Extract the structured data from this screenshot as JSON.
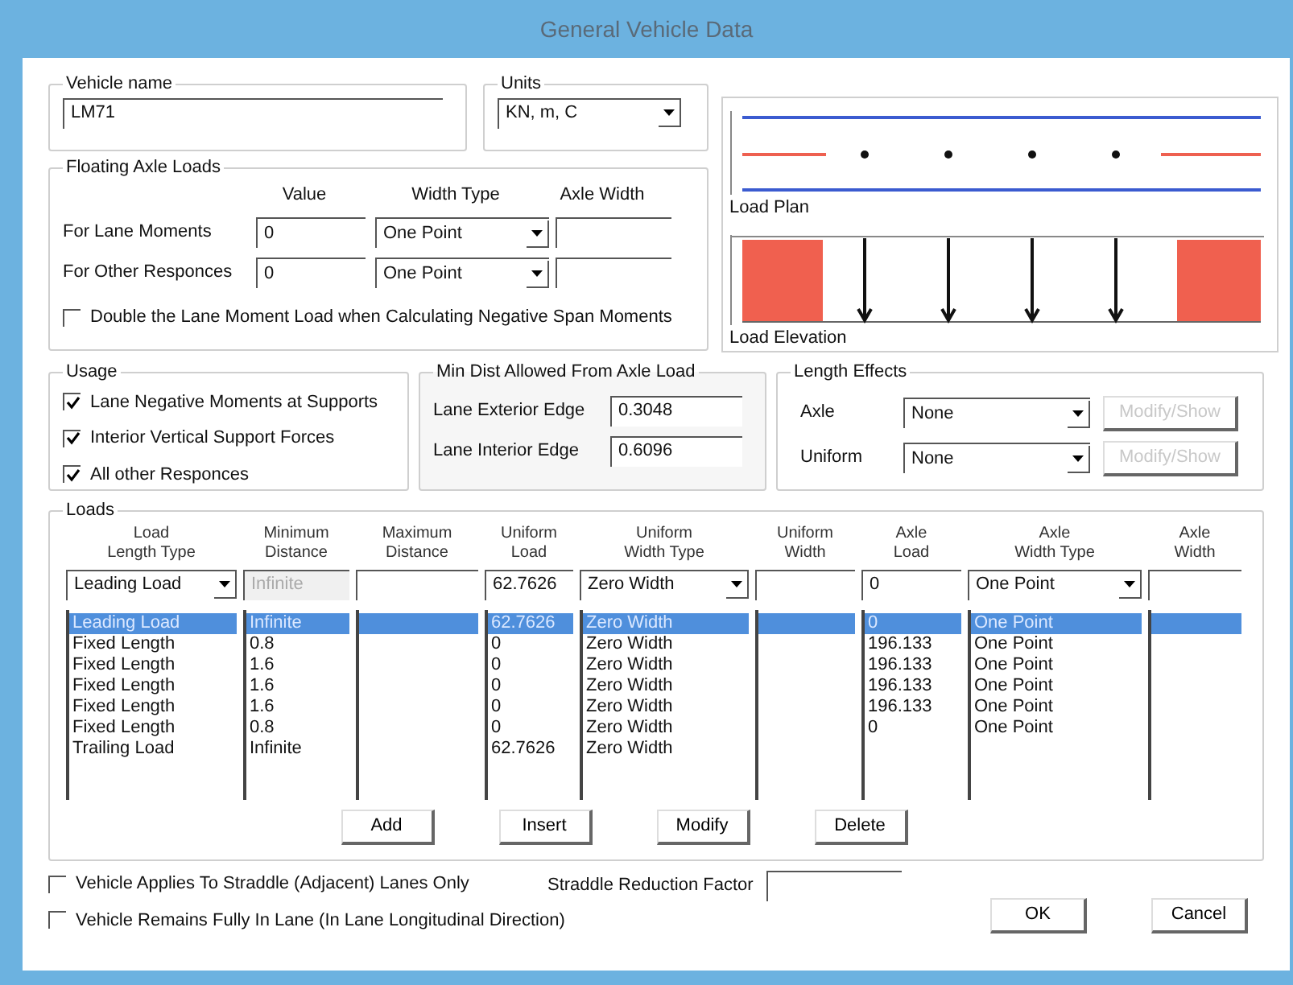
{
  "window": {
    "title": "General Vehicle Data"
  },
  "vehicle_name": {
    "label": "Vehicle name",
    "value": "LM71"
  },
  "units": {
    "label": "Units",
    "value": "KN, m, C"
  },
  "floating_axle_loads": {
    "title": "Floating Axle Loads",
    "columns": [
      "Value",
      "Width Type",
      "Axle Width"
    ],
    "rows": [
      {
        "label": "For Lane Moments",
        "value": "0",
        "width_type": "One Point"
      },
      {
        "label": "For Other Responces",
        "value": "0",
        "width_type": "One Point"
      }
    ],
    "double_option": {
      "label": "Double the Lane Moment Load when Calculating Negative Span Moments",
      "checked": false
    }
  },
  "load_plan": {
    "label": "Load Plan"
  },
  "load_elevation": {
    "label": "Load Elevation"
  },
  "usage": {
    "title": "Usage",
    "options": [
      {
        "label": "Lane Negative Moments at Supports",
        "checked": true
      },
      {
        "label": "Interior Vertical Support Forces",
        "checked": true
      },
      {
        "label": "All other Responces",
        "checked": true
      }
    ]
  },
  "min_dist": {
    "title": "Min Dist Allowed From Axle Load",
    "fields": [
      {
        "label": "Lane Exterior Edge",
        "value": "0.3048"
      },
      {
        "label": "Lane Interior Edge",
        "value": "0.6096"
      }
    ]
  },
  "length_effects": {
    "title": "Length Effects",
    "rows": [
      {
        "label": "Axle",
        "value": "None",
        "button": "Modify/Show",
        "disabled": true
      },
      {
        "label": "Uniform",
        "value": "None",
        "button": "Modify/Show",
        "disabled": true
      }
    ]
  },
  "loads": {
    "title": "Loads",
    "columns": [
      {
        "lines": [
          "Load",
          "Length Type"
        ],
        "kind": "select"
      },
      {
        "lines": [
          "Minimum",
          "Distance"
        ],
        "kind": "text"
      },
      {
        "lines": [
          "Maximum",
          "Distance"
        ],
        "kind": "text"
      },
      {
        "lines": [
          "Uniform",
          "Load"
        ],
        "kind": "text"
      },
      {
        "lines": [
          "Uniform",
          "Width Type"
        ],
        "kind": "select"
      },
      {
        "lines": [
          "Uniform",
          "Width"
        ],
        "kind": "text"
      },
      {
        "lines": [
          "Axle",
          "Load"
        ],
        "kind": "text"
      },
      {
        "lines": [
          "Axle",
          "Width Type"
        ],
        "kind": "select"
      },
      {
        "lines": [
          "Axle",
          "Width"
        ],
        "kind": "text"
      }
    ],
    "edit_row": [
      {
        "value": "Leading Load",
        "disabled": false
      },
      {
        "value": "Infinite",
        "disabled": true
      },
      {
        "disabled": false
      },
      {
        "value": "62.7626",
        "disabled": false
      },
      {
        "value": "Zero Width",
        "disabled": false
      },
      {
        "disabled": false
      },
      {
        "value": "0",
        "disabled": false
      },
      {
        "value": "One Point",
        "disabled": false
      },
      {
        "disabled": false
      }
    ],
    "rows": [
      {
        "selected": true,
        "cells": [
          {
            "text": "Leading Load"
          },
          {
            "text": "Infinite"
          },
          {},
          {
            "text": "62.7626"
          },
          {
            "text": "Zero Width"
          },
          {},
          {
            "text": "0"
          },
          {
            "text": "One Point"
          },
          {}
        ]
      },
      {
        "selected": false,
        "cells": [
          {
            "text": "Fixed Length"
          },
          {
            "text": "0.8"
          },
          {},
          {
            "text": "0"
          },
          {
            "text": "Zero Width"
          },
          {},
          {
            "text": "196.133"
          },
          {
            "text": "One Point"
          },
          {}
        ]
      },
      {
        "selected": false,
        "cells": [
          {
            "text": "Fixed Length"
          },
          {
            "text": "1.6"
          },
          {},
          {
            "text": "0"
          },
          {
            "text": "Zero Width"
          },
          {},
          {
            "text": "196.133"
          },
          {
            "text": "One Point"
          },
          {}
        ]
      },
      {
        "selected": false,
        "cells": [
          {
            "text": "Fixed Length"
          },
          {
            "text": "1.6"
          },
          {},
          {
            "text": "0"
          },
          {
            "text": "Zero Width"
          },
          {},
          {
            "text": "196.133"
          },
          {
            "text": "One Point"
          },
          {}
        ]
      },
      {
        "selected": false,
        "cells": [
          {
            "text": "Fixed Length"
          },
          {
            "text": "1.6"
          },
          {},
          {
            "text": "0"
          },
          {
            "text": "Zero Width"
          },
          {},
          {
            "text": "196.133"
          },
          {
            "text": "One Point"
          },
          {}
        ]
      },
      {
        "selected": false,
        "cells": [
          {
            "text": "Fixed Length"
          },
          {
            "text": "0.8"
          },
          {},
          {
            "text": "0"
          },
          {
            "text": "Zero Width"
          },
          {},
          {
            "text": "0"
          },
          {
            "text": "One Point"
          },
          {}
        ]
      },
      {
        "selected": false,
        "cells": [
          {
            "text": "Trailing Load"
          },
          {
            "text": "Infinite"
          },
          {},
          {
            "text": "62.7626"
          },
          {
            "text": "Zero Width"
          },
          {},
          {},
          {},
          {}
        ]
      }
    ],
    "buttons": [
      "Add",
      "Insert",
      "Modify",
      "Delete"
    ]
  },
  "options": [
    {
      "label": "Vehicle Applies To Straddle (Adjacent) Lanes Only",
      "checked": false
    },
    {
      "label": "Vehicle Remains Fully In Lane (In Lane Longitudinal Direction)",
      "checked": false
    }
  ],
  "straddle": {
    "label": "Straddle Reduction Factor"
  },
  "buttons": [
    "OK",
    "Cancel"
  ]
}
